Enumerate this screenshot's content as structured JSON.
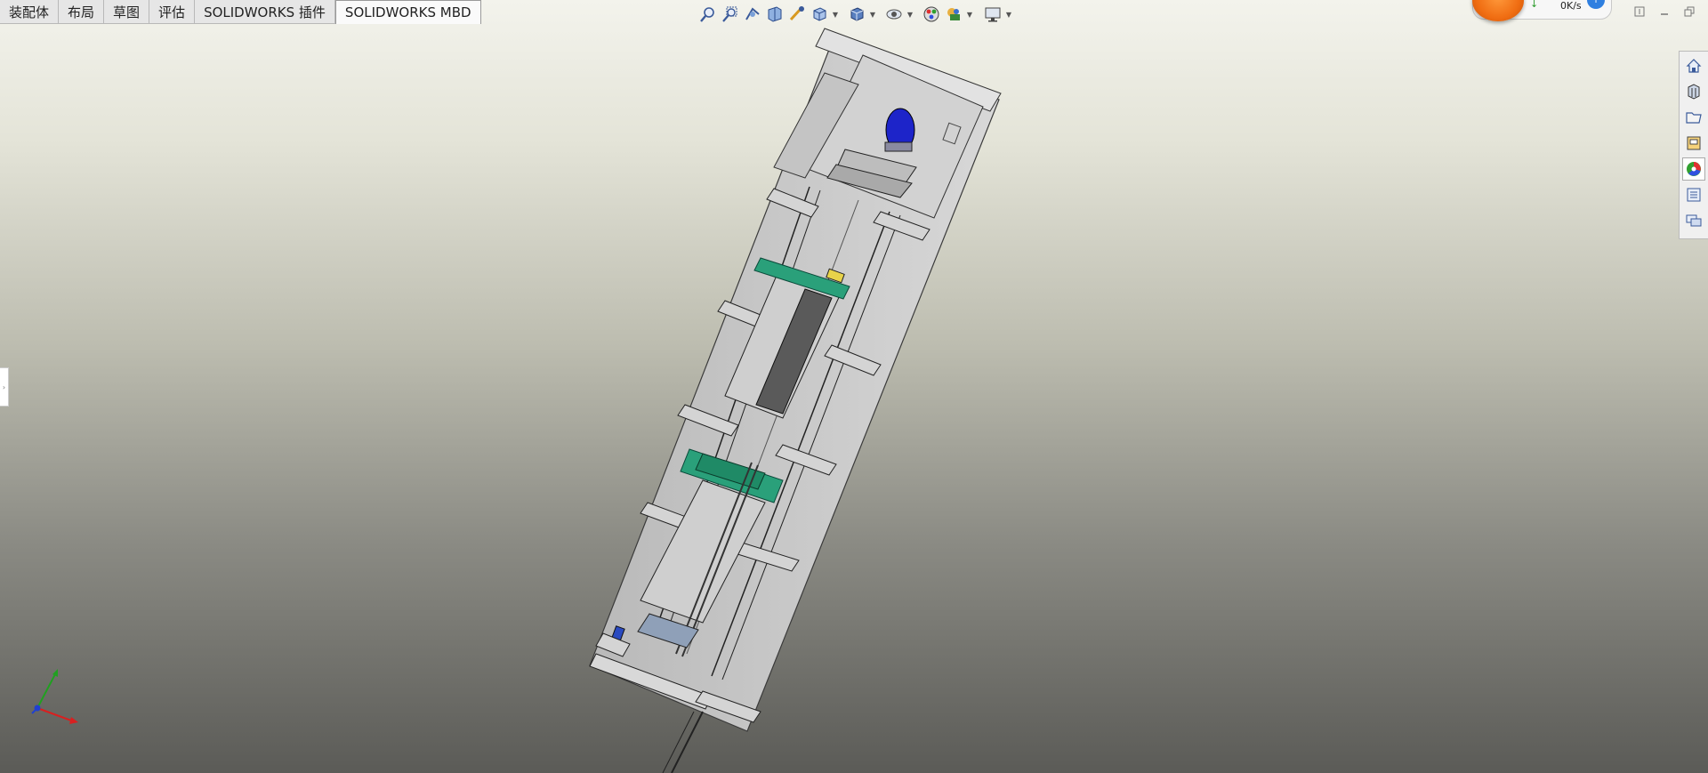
{
  "ribbon": {
    "tabs": [
      {
        "label": "装配体"
      },
      {
        "label": "布局"
      },
      {
        "label": "草图"
      },
      {
        "label": "评估"
      },
      {
        "label": "SOLIDWORKS 插件"
      },
      {
        "label": "SOLIDWORKS MBD",
        "active": true
      }
    ]
  },
  "view_toolbar": {
    "icons": [
      "zoom-to-fit-icon",
      "zoom-area-icon",
      "previous-view-icon",
      "section-view-icon",
      "dynamic-annotation-icon",
      "view-orientation-icon",
      "display-style-icon",
      "hide-show-items-icon",
      "edit-appearance-icon",
      "apply-scene-icon",
      "view-settings-icon"
    ]
  },
  "network_widget": {
    "speed": "0K/s",
    "info_glyph": "i"
  },
  "window_controls": {
    "icons": [
      "pin-icon",
      "minimize-icon",
      "restore-icon"
    ]
  },
  "task_pane": {
    "icons": [
      "solidworks-resources-icon",
      "design-library-icon",
      "file-explorer-icon",
      "view-palette-icon",
      "appearances-scenes-icon",
      "custom-properties-icon",
      "forum-icon"
    ],
    "active_index": 4
  },
  "colors": {
    "model_gray": "#c9c9c9",
    "model_green": "#2aa07a",
    "model_blue": "#1d24c9",
    "model_yellow": "#e8d34a",
    "axis_x": "#d82020",
    "axis_y": "#20a020",
    "axis_z": "#2040d0"
  }
}
